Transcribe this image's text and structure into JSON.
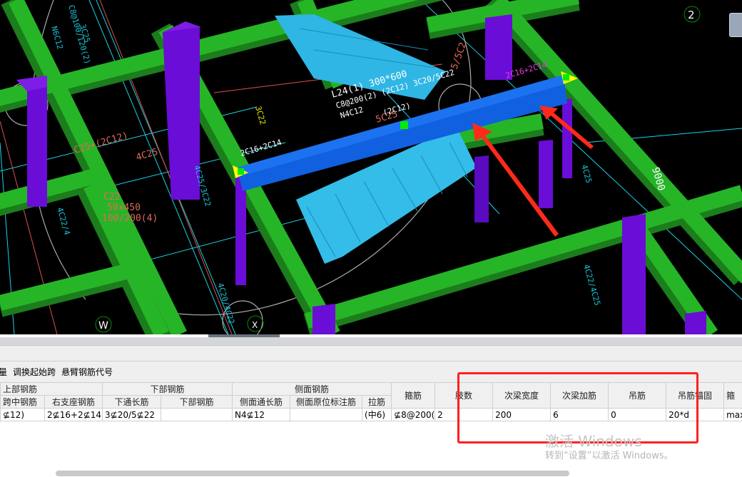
{
  "viewport": {
    "axis_labels": {
      "top_right": "2",
      "bottom_left": "W",
      "bottom_mid": "X"
    },
    "dimension": "9000",
    "annotations": {
      "beam_label_1": "L24(1) 300*600",
      "beam_label_2": "C8@200(2) (2C12) 3C20/5C22",
      "beam_label_3": "N4C12",
      "beam_label_4": "5C25",
      "beam_label_5": "(2C12)",
      "left_support": "2C16+2C14",
      "right_support": "2C16+2C14",
      "col_text_1": "3C25",
      "col_text_2": "C8@100/120(2)",
      "col_text_3": "N6C12",
      "red_1": "C25+(2C12)",
      "red_2": "4C25",
      "red_3": "C22",
      "red_4": "50x450",
      "red_5": "100/200(4)",
      "cyan_1": "4C25/3C22",
      "cyan_2": "4C22/4",
      "cyan_3": "4C20/4C22",
      "cyan_4": "4C25",
      "cyan_5": "4C22/4C25",
      "red_top": "5/5C2",
      "yellow_1": "3C22"
    },
    "colors": {
      "beam": "#26b526",
      "column": "#6a0dd6",
      "selected_beam": "#0f5fe0",
      "stair": "#2fb6e4",
      "arrow": "#ff2a1a"
    }
  },
  "toolbar": {
    "items": [
      "量",
      "调换起始跨",
      "悬臂钢筋代号"
    ]
  },
  "table": {
    "group_headers": {
      "top_rebar": "上部钢筋",
      "bottom_rebar": "下部钢筋",
      "side_rebar": "侧面钢筋"
    },
    "columns": [
      "跨中钢筋",
      "右支座钢筋",
      "下通长筋",
      "下部钢筋",
      "侧面通长筋",
      "侧面原位标注筋",
      "拉筋",
      "箍筋",
      "肢数",
      "次梁宽度",
      "次梁加筋",
      "吊筋",
      "吊筋锚固",
      "箍"
    ],
    "rows": [
      [
        "⊈12)",
        "2⊈16+2⊈14",
        "3⊈20/5⊈22",
        "",
        "N4⊈12",
        "",
        "(中6)",
        "⊈8@200(",
        "2",
        "200",
        "6",
        "0",
        "20*d",
        "max"
      ]
    ]
  },
  "watermark": {
    "line1": "激活 Windows",
    "line2": "转到“设置”以激活 Windows。"
  }
}
